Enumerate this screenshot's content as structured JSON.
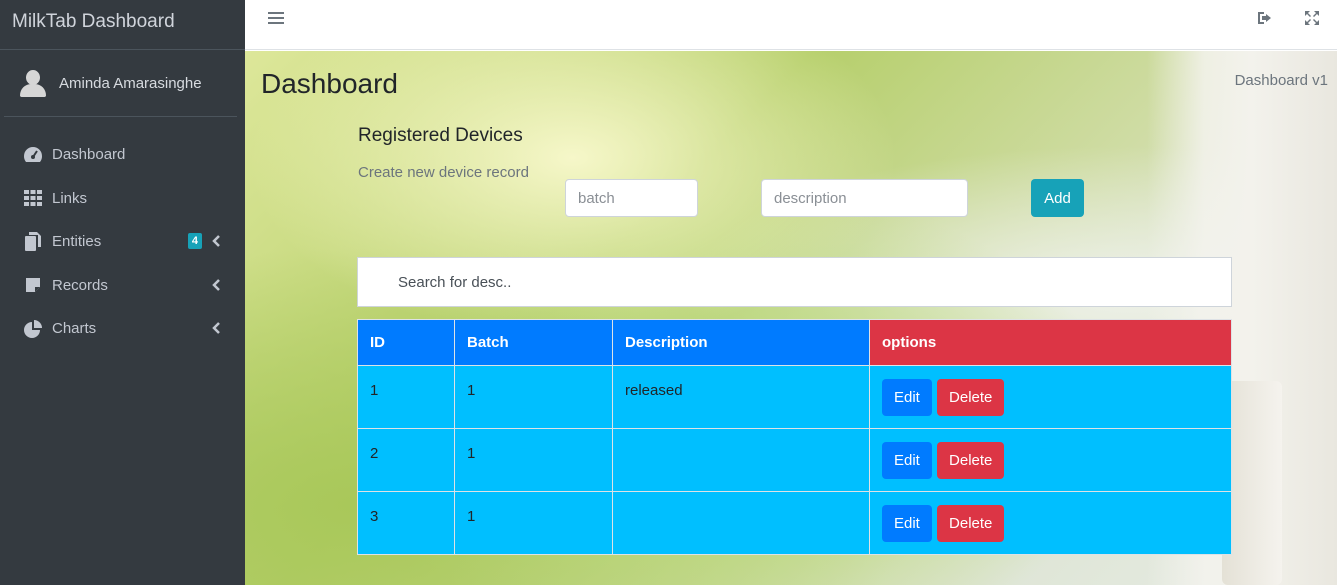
{
  "brand": {
    "title": "MilkTab Dashboard"
  },
  "user": {
    "name": "Aminda Amarasinghe"
  },
  "sidebar": {
    "items": [
      {
        "label": "Dashboard",
        "icon": "tachometer-icon"
      },
      {
        "label": "Links",
        "icon": "grid-icon"
      },
      {
        "label": "Entities",
        "icon": "copy-icon",
        "badge": "4"
      },
      {
        "label": "Records",
        "icon": "note-icon"
      },
      {
        "label": "Charts",
        "icon": "pie-chart-icon"
      }
    ]
  },
  "header": {
    "title": "Dashboard",
    "breadcrumb": "Dashboard v1"
  },
  "form": {
    "section_title": "Registered Devices",
    "create_label": "Create new device record",
    "batch_placeholder": "batch",
    "description_placeholder": "description",
    "add_label": "Add"
  },
  "search": {
    "placeholder": "Search for desc.."
  },
  "table": {
    "columns": [
      "ID",
      "Batch",
      "Description",
      "options"
    ],
    "rows": [
      {
        "id": "1",
        "batch": "1",
        "description": "released"
      },
      {
        "id": "2",
        "batch": "1",
        "description": ""
      },
      {
        "id": "3",
        "batch": "1",
        "description": ""
      }
    ],
    "edit_label": "Edit",
    "delete_label": "Delete"
  },
  "colors": {
    "sidebar_bg": "#343a40",
    "primary": "#007bff",
    "danger": "#dc3545",
    "info": "#17a2b8",
    "row_bg": "#00bfff"
  }
}
